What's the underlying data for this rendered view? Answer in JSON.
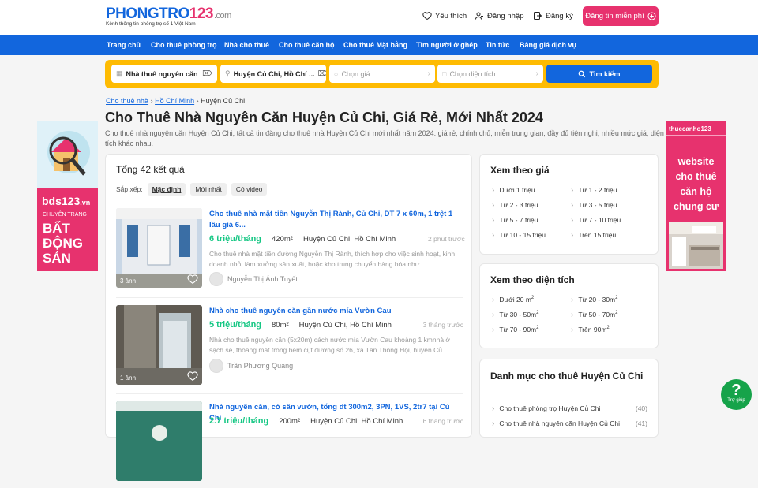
{
  "header": {
    "logo_main": "PHONGTRO",
    "logo_num": "123",
    "logo_domain": ".com",
    "logo_tagline": "Kênh thông tin phòng trọ số 1 Việt Nam",
    "favorites": "Yêu thích",
    "login": "Đăng nhập",
    "register": "Đăng ký",
    "post_free": "Đăng tin miễn phí"
  },
  "nav": [
    "Trang chủ",
    "Cho thuê phòng trọ",
    "Nhà cho thuê",
    "Cho thuê căn hộ",
    "Cho thuê Mặt bằng",
    "Tìm người ở ghép",
    "Tin tức",
    "Bảng giá dịch vụ"
  ],
  "search": {
    "category": "Nhà thuê nguyên căn",
    "location": "Huyện Củ Chi, Hồ Chí ...",
    "price_placeholder": "Chọn giá",
    "area_placeholder": "Chọn diện tích",
    "button": "Tìm kiếm"
  },
  "breadcrumb": {
    "c1": "Cho thuê nhà",
    "c2": "Hồ Chí Minh",
    "c3": "Huyện Củ Chi"
  },
  "page": {
    "title": "Cho Thuê Nhà Nguyên Căn Huyện Củ Chi, Giá Rẻ, Mới Nhất 2024",
    "description": "Cho thuê nhà nguyên căn Huyện Củ Chi, tất cả tin đăng cho thuê nhà Huyện Củ Chi mới nhất năm 2024: giá rẻ, chính chủ, miễn trung gian, đầy đủ tiện nghi, nhiều mức giá, diện tích khác nhau."
  },
  "listing": {
    "total": "Tổng 42 kết quả",
    "sort_label": "Sắp xếp:",
    "sort_default": "Mặc định",
    "sort_newest": "Mới nhất",
    "sort_video": "Có video",
    "items": [
      {
        "title": "Cho thuê nhà mặt tiền Nguyễn Thị Rành, Củ Chi, DT 7 x 60m, 1 trệt 1 lầu giá 6...",
        "price": "6 triệu/tháng",
        "area": "420m²",
        "location": "Huyện Củ Chi, Hồ Chí Minh",
        "time": "2 phút trước",
        "desc": "Cho thuê nhà mặt tiền đường Nguyễn Thị Rành, thích hợp cho việc sinh hoạt, kinh doanh nhỏ, làm xưởng sản xuất, hoặc kho trung chuyển hàng hóa như...",
        "user": "Nguyễn Thị Ánh Tuyết",
        "images": "3 ảnh"
      },
      {
        "title": "Nhà cho thuê nguyên căn gần nước mía Vườn Cau",
        "price": "5 triệu/tháng",
        "area": "80m²",
        "location": "Huyện Củ Chi, Hồ Chí Minh",
        "time": "3 tháng trước",
        "desc": "Nhà cho thuê nguyên căn (5x20m) cách nước mía Vườn Cau khoảng 1 kmnhà ở sạch sẽ, thoáng mát trong hẻm cụt đường số 26, xã Tân Thông Hội, huyện Củ...",
        "user": "Trần Phương Quang",
        "images": "1 ảnh"
      },
      {
        "title": "Nhà nguyên căn, có sân vườn, tổng dt 300m2, 3PN, 1VS, 2tr7 tại Củ Chi",
        "price": "2.7 triệu/tháng",
        "area": "200m²",
        "location": "Huyện Củ Chi, Hồ Chí Minh",
        "time": "6 tháng trước"
      }
    ]
  },
  "price_box": {
    "title": "Xem theo giá",
    "items": [
      "Dưới 1 triệu",
      "Từ 1 - 2 triệu",
      "Từ 2 - 3 triệu",
      "Từ 3 - 5 triệu",
      "Từ 5 - 7 triệu",
      "Từ 7 - 10 triệu",
      "Từ 10 - 15 triệu",
      "Trên 15 triệu"
    ]
  },
  "area_box": {
    "title": "Xem theo diện tích",
    "items": [
      "Dưới 20 m",
      "Từ 20 - 30m",
      "Từ 30 - 50m",
      "Từ 50 - 70m",
      "Từ 70 - 90m",
      "Trên 90m"
    ],
    "sup": "2"
  },
  "category_box": {
    "title": "Danh mục cho thuê Huyện Củ Chi",
    "items": [
      {
        "label": "Cho thuê phòng trọ Huyện Củ Chi",
        "count": "(40)"
      },
      {
        "label": "Cho thuê nhà nguyên căn Huyện Củ Chi",
        "count": "(41)"
      }
    ]
  },
  "banners": {
    "left_site": "bds123",
    "left_tld": ".vn",
    "left_tag": "CHUYÊN TRANG",
    "left_l1": "BẤT",
    "left_l2": "ĐỘNG",
    "left_l3": "SẢN",
    "right_site": "thuecanho123",
    "right_l1": "website",
    "right_l2": "cho thuê",
    "right_l3": "căn hộ",
    "right_l4": "chung cư"
  },
  "help": {
    "label": "Trợ giúp"
  },
  "colors": {
    "brand_blue": "#1266dd",
    "brand_pink": "#e7326e",
    "search_yellow": "#febb02",
    "price_green": "#16c784"
  }
}
